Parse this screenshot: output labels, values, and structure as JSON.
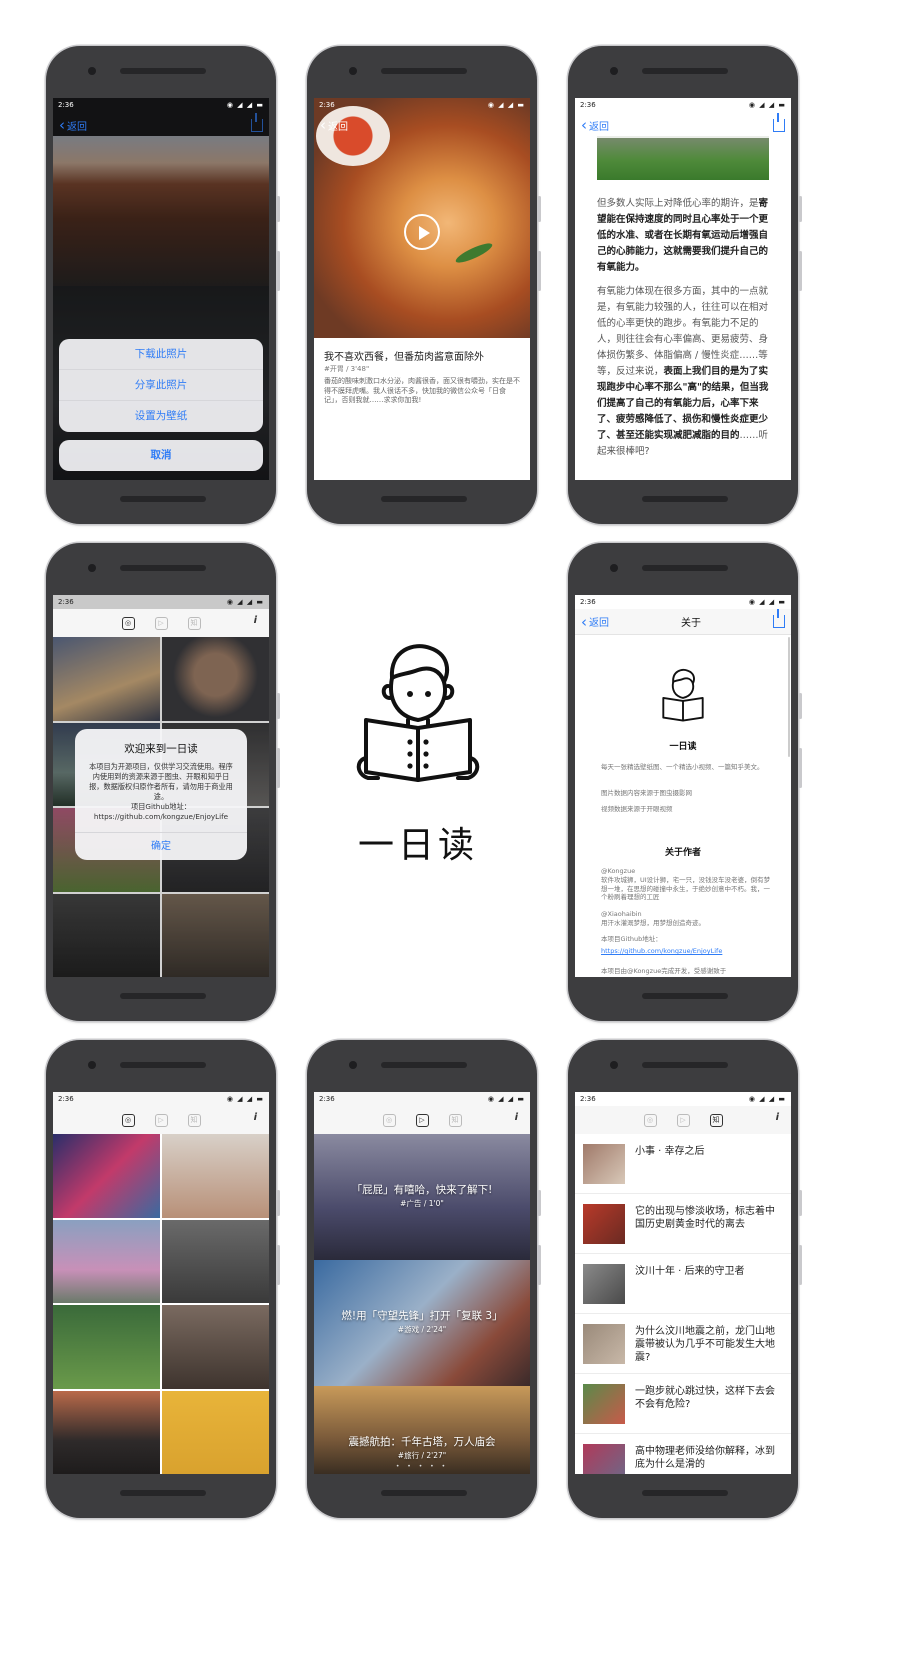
{
  "status": {
    "time": "2:36",
    "indicators": "◉ ◢ ◢ ▬"
  },
  "nav": {
    "back_label": "返回"
  },
  "screen1": {
    "sheet_items": [
      "下载此照片",
      "分享此照片",
      "设置为壁纸"
    ],
    "cancel_label": "取消"
  },
  "screen2": {
    "title": "我不喜欢西餐，但番茄肉酱意面除外",
    "tag": "#开胃 / 3'48\"",
    "description": "番茄的酸味刺激口水分泌，肉酱很香，面又很有嚼劲，实在是不得不膜拜虎嘴。我人很话不多，快加我的微信公众号「日食记」，否则我就……求求你加我!"
  },
  "screen3": {
    "p1_plain": "但多数人实际上对降低心率的期许，是",
    "p1_bold": "寄望能在保持速度的同时且心率处于一个更低的水准、或者在长期有氧运动后增强自己的心肺能力，这就需要我们提升自己的有氧能力。",
    "p2_plain": "有氧能力体现在很多方面，其中的一点就是，有氧能力较强的人，往往可以在相对低的心率更快的跑步。有氧能力不足的人，则往往会有心率偏高、更易疲劳、身体损伤繁多、体脂偏高 / 慢性炎症……等等，反过来说，",
    "p2_bold": "表面上我们目的是为了实现跑步中心率不那么\"高\"的结果，但当我们提高了自己的有氧能力后，心率下来了、疲劳感降低了、损伤和慢性炎症更少了、甚至还能实现减肥减脂的目的",
    "p2_tail": "……听起来很棒吧?"
  },
  "tabs": {
    "photo": "◎",
    "video": "▷",
    "article": "知",
    "info": "i"
  },
  "screen4": {
    "alert_title": "欢迎来到一日读",
    "alert_message": "本项目为开源项目，仅供学习交流使用。程序内使用到的资源来源于图虫、开眼和知乎日报，数据版权归原作者所有，请勿用于商业用途。",
    "alert_github_label": "项目Github地址：",
    "alert_github_url": "https://github.com/kongzue/EnjoyLife",
    "alert_ok": "确定"
  },
  "center": {
    "app_name": "一日读"
  },
  "screen6": {
    "nav_title": "关于",
    "app_name": "一日读",
    "line1": "每天一张精选壁纸图、一个精选小视频、一篇知乎美文。",
    "line2": "图片数据内容来源于图虫摄影网",
    "line3": "视频数据来源于开眼视频",
    "about_heading": "关于作者",
    "author1_name": "@Kongzue",
    "author1_desc": "软件攻城狮，UI设计狮，宅一只，没钱没车没老婆，倒有梦想一堆，在思想的碰撞中永生，于绝妙创意中不朽。我，一个粉刷着理想的工匠",
    "author2_name": "@Xiaohaibin",
    "author2_desc": "用汗水灌溉梦想，用梦想创造奇迹。",
    "github_label": "本项目Github地址：",
    "github_url": "https://github.com/kongzue/EnjoyLife",
    "footer": "本项目由@Kongzue完成开发，受感谢致于"
  },
  "screen8": {
    "videos": [
      {
        "title": "「屁屁」有嘻哈，快来了解下!",
        "meta": "#广告 / 1'0\""
      },
      {
        "title": "燃!用「守望先锋」打开「复联 3」",
        "meta": "#游戏 / 2'24\""
      },
      {
        "title": "震撼航拍：千年古塔，万人庙会",
        "meta": "#旅行 / 2'27\""
      }
    ],
    "dots": "• • • • •"
  },
  "screen9": {
    "articles": [
      "小事 · 幸存之后",
      "它的出现与惨淡收场，标志着中国历史剧黄金时代的离去",
      "汶川十年 · 后来的守卫者",
      "为什么汶川地震之前，龙门山地震带被认为几乎不可能发生大地震?",
      "一跑步就心跳过快，这样下去会不会有危险?",
      "高中物理老师没给你解释，冰到底为什么是滑的"
    ]
  },
  "colors": {
    "accent": "#2f7cf6",
    "phone_body": "#3d3d3f"
  }
}
